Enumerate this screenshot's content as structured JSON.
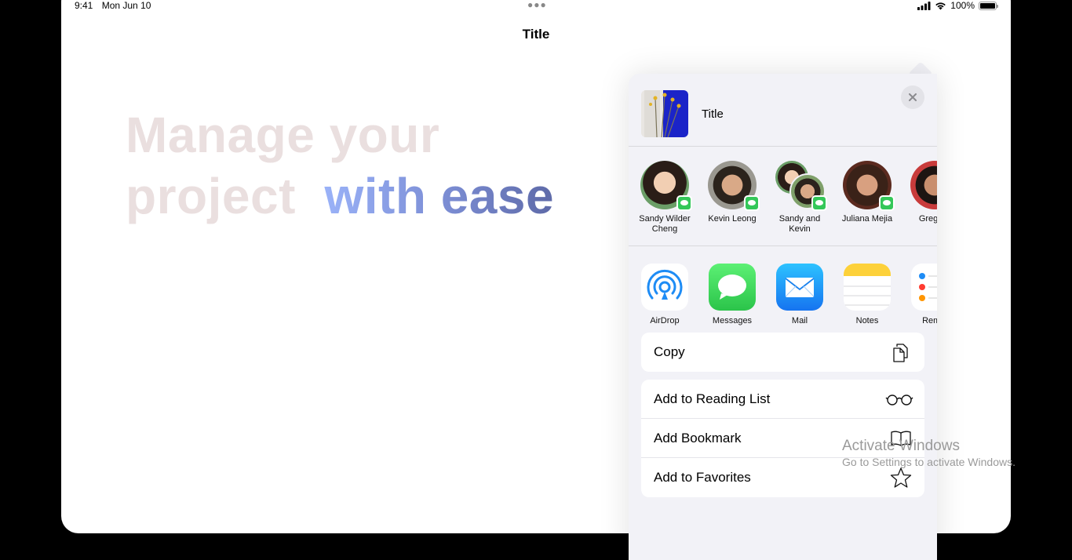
{
  "status": {
    "time": "9:41",
    "date": "Mon Jun 10",
    "battery": "100%",
    "battery_level": 1.0
  },
  "nav": {
    "title": "Title"
  },
  "hero": {
    "line1": "Manage your",
    "line2a": "project",
    "line2b": "with ease"
  },
  "share": {
    "title": "Title",
    "close_icon": "xmark-icon",
    "people": [
      {
        "name_line1": "Sandy Wilder",
        "name_line2": "Cheng"
      },
      {
        "name_line1": "Kevin Leong",
        "name_line2": ""
      },
      {
        "name_line1": "Sandy and",
        "name_line2": "Kevin"
      },
      {
        "name_line1": "Juliana Mejia",
        "name_line2": ""
      },
      {
        "name_line1": "Greg Ap",
        "name_line2": ""
      }
    ],
    "apps": [
      {
        "label": "AirDrop",
        "icon": "airdrop-icon"
      },
      {
        "label": "Messages",
        "icon": "messages-icon"
      },
      {
        "label": "Mail",
        "icon": "mail-icon"
      },
      {
        "label": "Notes",
        "icon": "notes-icon"
      },
      {
        "label": "Remin",
        "icon": "reminders-icon"
      }
    ],
    "actions_group1": [
      {
        "label": "Copy",
        "icon": "copy-icon"
      }
    ],
    "actions_group2": [
      {
        "label": "Add to Reading List",
        "icon": "glasses-icon"
      },
      {
        "label": "Add Bookmark",
        "icon": "book-icon"
      },
      {
        "label": "Add to Favorites",
        "icon": "star-icon"
      }
    ]
  },
  "watermark": {
    "line1": "Activate Windows",
    "line2": "Go to Settings to activate Windows."
  },
  "colors": {
    "hero_muted": "#eadfdf",
    "hero_accent_start": "#9ab2f8",
    "hero_accent_end": "#5e6aa8",
    "messages_green": "#34c759",
    "mail_blue": "#1e8cf5",
    "sheet_bg": "#f2f2f7"
  }
}
